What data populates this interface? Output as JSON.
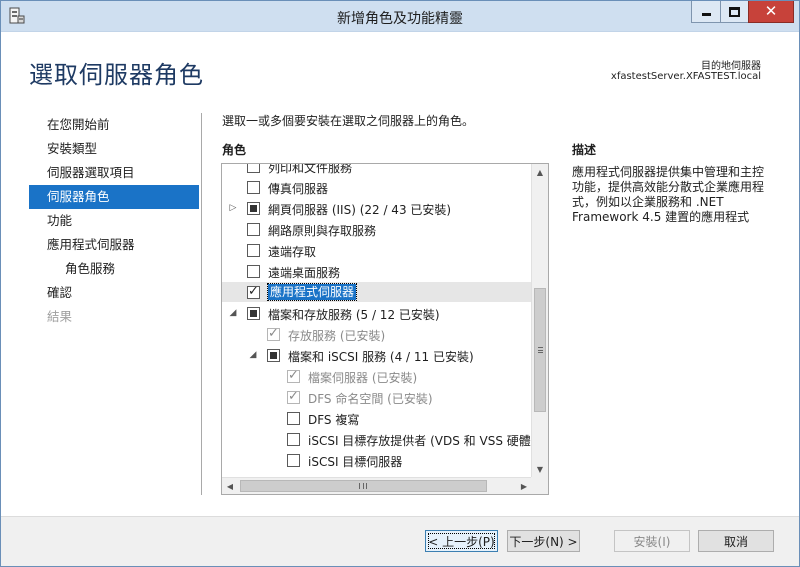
{
  "window": {
    "title": "新增角色及功能精靈"
  },
  "header": {
    "page_title": "選取伺服器角色",
    "destination_label": "目的地伺服器",
    "destination_value": "xfastestServer.XFASTEST.local"
  },
  "nav": {
    "items": [
      {
        "label": "在您開始前",
        "state": "normal",
        "indent": 0
      },
      {
        "label": "安裝類型",
        "state": "normal",
        "indent": 0
      },
      {
        "label": "伺服器選取項目",
        "state": "normal",
        "indent": 0
      },
      {
        "label": "伺服器角色",
        "state": "active",
        "indent": 0
      },
      {
        "label": "功能",
        "state": "normal",
        "indent": 0
      },
      {
        "label": "應用程式伺服器",
        "state": "normal",
        "indent": 0
      },
      {
        "label": "角色服務",
        "state": "normal",
        "indent": 1
      },
      {
        "label": "確認",
        "state": "normal",
        "indent": 0
      },
      {
        "label": "結果",
        "state": "disabled",
        "indent": 0
      }
    ]
  },
  "main": {
    "instruction": "選取一或多個要安裝在選取之伺服器上的角色。",
    "roles_label": "角色",
    "description_label": "描述",
    "description_text": "應用程式伺服器提供集中管理和主控功能，提供高效能分散式企業應用程式，例如以企業服務和 .NET Framework 4.5 建置的應用程式"
  },
  "tree": {
    "rows": [
      {
        "label": "列印和文件服務",
        "check": "none",
        "expander": "",
        "indent": 0,
        "disabled": false,
        "clipped": true
      },
      {
        "label": "傳真伺服器",
        "check": "none",
        "expander": "",
        "indent": 0,
        "disabled": false
      },
      {
        "label": "網頁伺服器 (IIS) (22 / 43 已安裝)",
        "check": "partial",
        "expander": "collapsed",
        "indent": 0,
        "disabled": false
      },
      {
        "label": "網路原則與存取服務",
        "check": "none",
        "expander": "",
        "indent": 0,
        "disabled": false
      },
      {
        "label": "遠端存取",
        "check": "none",
        "expander": "",
        "indent": 0,
        "disabled": false
      },
      {
        "label": "遠端桌面服務",
        "check": "none",
        "expander": "",
        "indent": 0,
        "disabled": false
      },
      {
        "label": "應用程式伺服器",
        "check": "checked",
        "expander": "",
        "indent": 0,
        "disabled": false,
        "selected": true
      },
      {
        "label": "檔案和存放服務 (5 / 12 已安裝)",
        "check": "partial",
        "expander": "expanded",
        "indent": 0,
        "disabled": false
      },
      {
        "label": "存放服務 (已安裝)",
        "check": "checked",
        "expander": "",
        "indent": 1,
        "disabled": true
      },
      {
        "label": "檔案和 iSCSI 服務 (4 / 11 已安裝)",
        "check": "partial",
        "expander": "expanded",
        "indent": 1,
        "disabled": false
      },
      {
        "label": "檔案伺服器 (已安裝)",
        "check": "checked",
        "expander": "",
        "indent": 2,
        "disabled": true
      },
      {
        "label": "DFS 命名空間 (已安裝)",
        "check": "checked",
        "expander": "",
        "indent": 2,
        "disabled": true
      },
      {
        "label": "DFS 複寫",
        "check": "none",
        "expander": "",
        "indent": 2,
        "disabled": false
      },
      {
        "label": "iSCSI 目標存放提供者 (VDS 和 VSS 硬體提供",
        "check": "none",
        "expander": "",
        "indent": 2,
        "disabled": false
      },
      {
        "label": "iSCSI 目標伺服器",
        "check": "none",
        "expander": "",
        "indent": 2,
        "disabled": false
      }
    ],
    "scroll_v_position": 0.55,
    "scroll_h_position": 0.0
  },
  "footer": {
    "prev_label": "< 上一步(P)",
    "next_label": "下一步(N) >",
    "install_label": "安裝(I)",
    "cancel_label": "取消"
  },
  "colors": {
    "accent": "#1a73c7",
    "title_bar": "#cfdff0",
    "close_button": "#c7423a",
    "heading": "#1e3a63"
  },
  "icons": {
    "app": "server-manager-icon",
    "minimize": "minimize-icon",
    "maximize": "maximize-icon",
    "close": "close-icon"
  }
}
